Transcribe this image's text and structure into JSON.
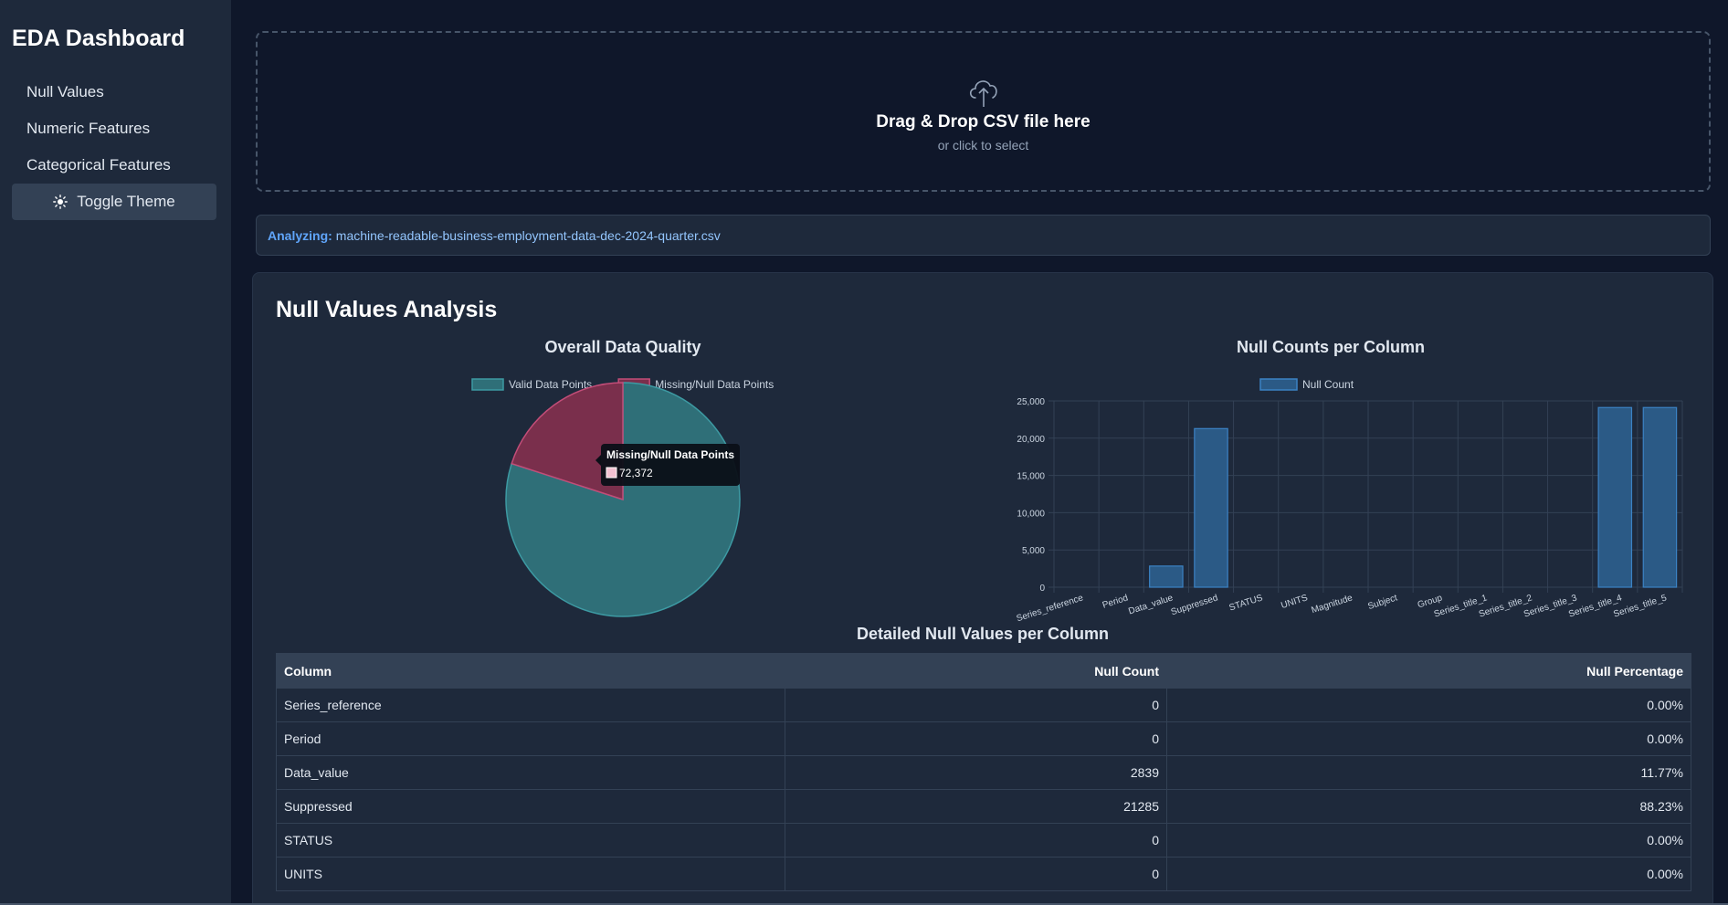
{
  "sidebar": {
    "title": "EDA Dashboard",
    "items": [
      {
        "label": "Null Values"
      },
      {
        "label": "Numeric Features"
      },
      {
        "label": "Categorical Features"
      }
    ],
    "toggle_label": "Toggle Theme",
    "toggle_icon": "sun-icon"
  },
  "dropzone": {
    "icon": "cloud-upload-icon",
    "title": "Drag & Drop CSV file here",
    "subtitle": "or click to select"
  },
  "analyzing": {
    "label": "Analyzing:",
    "filename": "machine-readable-business-employment-data-dec-2024-quarter.csv"
  },
  "panel": {
    "title": "Null Values Analysis",
    "table_title": "Detailed Null Values per Column"
  },
  "chart_data": [
    {
      "type": "pie",
      "title": "Overall Data Quality",
      "labels": [
        "Valid Data Points",
        "Missing/Null Data Points"
      ],
      "values": [
        289002,
        72372
      ],
      "colors": [
        "#2f6f78",
        "#7a2f4c"
      ],
      "tooltip": {
        "title": "Missing/Null Data Points",
        "value": "72,372"
      }
    },
    {
      "type": "bar",
      "title": "Null Counts per Column",
      "series": [
        {
          "name": "Null Count",
          "values": [
            0,
            0,
            2839,
            21285,
            0,
            0,
            0,
            0,
            0,
            0,
            0,
            0,
            24112,
            24112
          ]
        }
      ],
      "categories": [
        "Series_reference",
        "Period",
        "Data_value",
        "Suppressed",
        "STATUS",
        "UNITS",
        "Magnitude",
        "Subject",
        "Group",
        "Series_title_1",
        "Series_title_2",
        "Series_title_3",
        "Series_title_4",
        "Series_title_5"
      ],
      "ylim": [
        0,
        25000
      ],
      "yticks": [
        "0",
        "5,000",
        "10,000",
        "15,000",
        "20,000",
        "25,000"
      ],
      "grid": true,
      "legend": "top",
      "color": "#2b5a86"
    }
  ],
  "table": {
    "headers": [
      "Column",
      "Null Count",
      "Null Percentage"
    ],
    "rows": [
      [
        "Series_reference",
        "0",
        "0.00%"
      ],
      [
        "Period",
        "0",
        "0.00%"
      ],
      [
        "Data_value",
        "2839",
        "11.77%"
      ],
      [
        "Suppressed",
        "21285",
        "88.23%"
      ],
      [
        "STATUS",
        "0",
        "0.00%"
      ],
      [
        "UNITS",
        "0",
        "0.00%"
      ]
    ]
  }
}
